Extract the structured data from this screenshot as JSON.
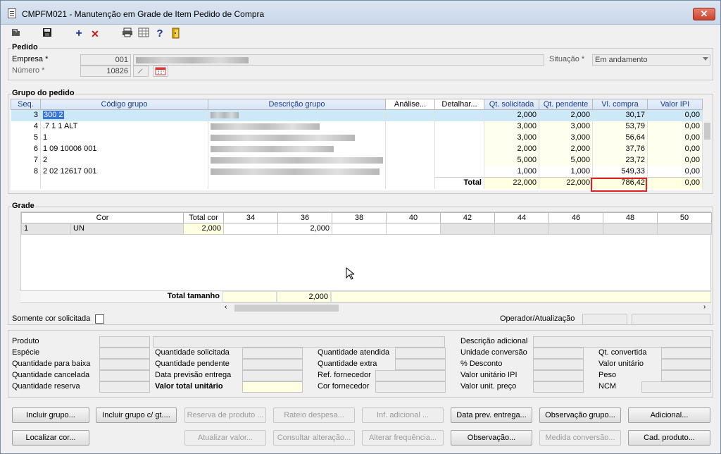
{
  "window": {
    "title": "CMPFM021 - Manutenção em Grade de Item Pedido de Compra",
    "close": "✕"
  },
  "toolbar": {
    "add": "+",
    "delete": "✕",
    "help": "?"
  },
  "pedido": {
    "section": "Pedido",
    "empresa_label": "Empresa *",
    "empresa_code": "001",
    "numero_label": "Número *",
    "numero_value": "10826",
    "situacao_label": "Situação *",
    "situacao_value": "Em andamento"
  },
  "grupo": {
    "section": "Grupo do pedido",
    "columns": [
      "Seq.",
      "Código grupo",
      "Descrição grupo",
      "Análise...",
      "Detalhar...",
      "Qt. solicitada",
      "Qt. pendente",
      "Vl. compra",
      "Valor IPI"
    ],
    "rows": [
      {
        "seq": "3",
        "codigo": "300 2",
        "qt_sol": "2,000",
        "qt_pend": "2,000",
        "vl": "30,17",
        "ipi": "0,00"
      },
      {
        "seq": "4",
        "codigo": ".7 1 1 ALT",
        "qt_sol": "3,000",
        "qt_pend": "3,000",
        "vl": "53,79",
        "ipi": "0,00"
      },
      {
        "seq": "5",
        "codigo": "1",
        "qt_sol": "3,000",
        "qt_pend": "3,000",
        "vl": "56,64",
        "ipi": "0,00"
      },
      {
        "seq": "6",
        "codigo": "1 09 10006 001",
        "qt_sol": "2,000",
        "qt_pend": "2,000",
        "vl": "37,76",
        "ipi": "0,00"
      },
      {
        "seq": "7",
        "codigo": "2",
        "qt_sol": "5,000",
        "qt_pend": "5,000",
        "vl": "23,72",
        "ipi": "0,00"
      },
      {
        "seq": "8",
        "codigo": "2 02 12617 001",
        "qt_sol": "1,000",
        "qt_pend": "1,000",
        "vl": "549,33",
        "ipi": "0,00"
      }
    ],
    "total_label": "Total",
    "total_qt_sol": "22,000",
    "total_qt_pend": "22,000",
    "total_vl": "786,42",
    "total_ipi": "0,00"
  },
  "grade": {
    "section": "Grade",
    "columns": [
      "Cor",
      "Total cor",
      "34",
      "36",
      "38",
      "40",
      "42",
      "44",
      "46",
      "48",
      "50"
    ],
    "row": {
      "seq": "1",
      "cor": "UN",
      "total": "2,000",
      "v36": "2,000"
    },
    "total_label": "Total tamanho",
    "total_36": "2,000"
  },
  "filters": {
    "somente_cor": "Somente cor solicitada",
    "operador": "Operador/Atualização"
  },
  "details": {
    "col1": [
      "Produto",
      "Espécie",
      "Quantidade para baixa",
      "Quantidade cancelada",
      "Quantidade reserva"
    ],
    "col2": [
      "Quantidade solicitada",
      "Quantidade pendente",
      "Data previsão entrega",
      "Valor total unitário"
    ],
    "col3": [
      "Quantidade atendida",
      "Quantidade extra",
      "Ref. fornecedor",
      "Cor fornecedor"
    ],
    "col4": [
      "Descrição adicional",
      "Unidade conversão",
      "% Desconto",
      "Valor unitário IPI",
      "Valor unit. preço"
    ],
    "col5": [
      "Qt. convertida",
      "Valor unitário",
      "Peso",
      "NCM"
    ]
  },
  "buttons": {
    "row1": [
      "Incluir grupo...",
      "Incluir grupo c/ gt....",
      "Reserva de produto ...",
      "Rateio despesa...",
      "Inf. adicional ...",
      "Data prev. entrega...",
      "Observação grupo...",
      "Adicional..."
    ],
    "row2": [
      "Localizar cor...",
      "Atualizar valor...",
      "Consultar alteração...",
      "Alterar frequência...",
      "Observação...",
      "Medida conversão...",
      "Cad. produto..."
    ]
  }
}
